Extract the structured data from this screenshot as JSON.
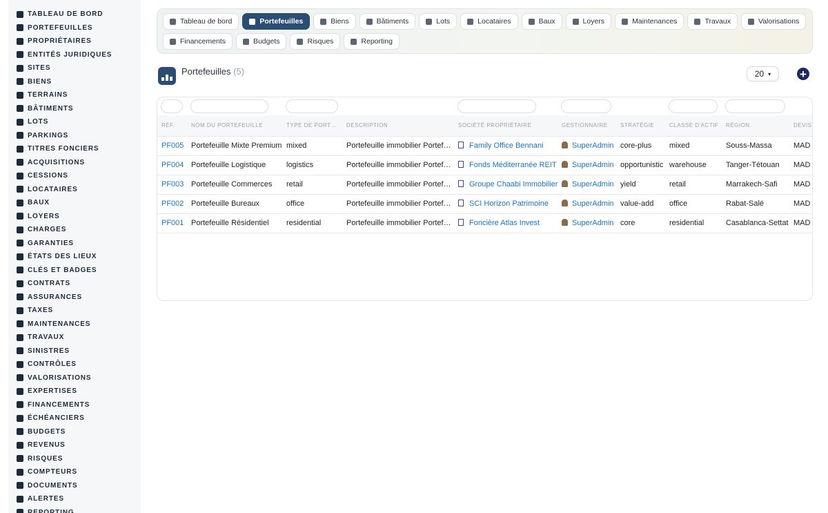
{
  "sidebar": {
    "items": [
      {
        "label": "TABLEAU DE BORD",
        "icon": "dashboard-icon"
      },
      {
        "label": "PORTEFEUILLES",
        "icon": "briefcase-icon"
      },
      {
        "label": "PROPRIÉTAIRES",
        "icon": "user-icon"
      },
      {
        "label": "ENTITÉS JURIDIQUES",
        "icon": "institution-icon"
      },
      {
        "label": "SITES",
        "icon": "city-icon"
      },
      {
        "label": "BIENS",
        "icon": "building-icon"
      },
      {
        "label": "TERRAINS",
        "icon": "vector-square-icon"
      },
      {
        "label": "BÂTIMENTS",
        "icon": "industry-icon"
      },
      {
        "label": "LOTS",
        "icon": "grid-icon"
      },
      {
        "label": "PARKINGS",
        "icon": "parking-icon"
      },
      {
        "label": "TITRES FONCIERS",
        "icon": "file-signature-icon"
      },
      {
        "label": "ACQUISITIONS",
        "icon": "handshake-icon"
      },
      {
        "label": "CESSIONS",
        "icon": "share-icon"
      },
      {
        "label": "LOCATAIRES",
        "icon": "users-icon"
      },
      {
        "label": "BAUX",
        "icon": "file-icon"
      },
      {
        "label": "LOYERS",
        "icon": "receipt-icon"
      },
      {
        "label": "CHARGES",
        "icon": "calculator-icon"
      },
      {
        "label": "GARANTIES",
        "icon": "shield-icon"
      },
      {
        "label": "ÉTATS DES LIEUX",
        "icon": "clipboard-check-icon"
      },
      {
        "label": "CLÉS ET BADGES",
        "icon": "key-icon"
      },
      {
        "label": "CONTRATS",
        "icon": "contract-icon"
      },
      {
        "label": "ASSURANCES",
        "icon": "umbrella-icon"
      },
      {
        "label": "TAXES",
        "icon": "percent-icon"
      },
      {
        "label": "MAINTENANCES",
        "icon": "tools-icon"
      },
      {
        "label": "TRAVAUX",
        "icon": "hard-hat-icon"
      },
      {
        "label": "SINISTRES",
        "icon": "warning-icon"
      },
      {
        "label": "CONTRÔLES",
        "icon": "clipboard-icon"
      },
      {
        "label": "VALORISATIONS",
        "icon": "scale-icon"
      },
      {
        "label": "EXPERTISES",
        "icon": "gavel-icon"
      },
      {
        "label": "FINANCEMENTS",
        "icon": "bank-icon"
      },
      {
        "label": "ÉCHÉANCIERS",
        "icon": "calendar-icon"
      },
      {
        "label": "BUDGETS",
        "icon": "coins-icon"
      },
      {
        "label": "REVENUS",
        "icon": "money-bill-icon"
      },
      {
        "label": "RISQUES",
        "icon": "exclamation-circle-icon"
      },
      {
        "label": "COMPTEURS",
        "icon": "gauge-icon"
      },
      {
        "label": "DOCUMENTS",
        "icon": "folder-open-icon"
      },
      {
        "label": "ALERTES",
        "icon": "bell-icon"
      },
      {
        "label": "REPORTING",
        "icon": "chart-pie-icon"
      }
    ]
  },
  "tabs": {
    "row1": [
      {
        "label": "Tableau de bord",
        "icon": "dashboard-icon",
        "active": false
      },
      {
        "label": "Portefeuilles",
        "icon": "briefcase-icon",
        "active": true
      },
      {
        "label": "Biens",
        "icon": "building-icon",
        "active": false
      },
      {
        "label": "Bâtiments",
        "icon": "industry-icon",
        "active": false
      },
      {
        "label": "Lots",
        "icon": "grid-icon",
        "active": false
      },
      {
        "label": "Locataires",
        "icon": "users-icon",
        "active": false
      },
      {
        "label": "Baux",
        "icon": "file-icon",
        "active": false
      },
      {
        "label": "Loyers",
        "icon": "receipt-icon",
        "active": false
      },
      {
        "label": "Maintenances",
        "icon": "tools-icon",
        "active": false
      },
      {
        "label": "Travaux",
        "icon": "hard-hat-icon",
        "active": false
      },
      {
        "label": "Valorisations",
        "icon": "scale-icon",
        "active": false
      }
    ],
    "row2": [
      {
        "label": "Financements",
        "icon": "bank-icon",
        "active": false
      },
      {
        "label": "Budgets",
        "icon": "coins-icon",
        "active": false
      },
      {
        "label": "Risques",
        "icon": "exclamation-circle-icon",
        "active": false
      },
      {
        "label": "Reporting",
        "icon": "chart-pie-icon",
        "active": false
      }
    ]
  },
  "header": {
    "title": "Portefeuilles",
    "count": "(5)",
    "page_size": "20",
    "add_label": "+"
  },
  "table": {
    "columns": [
      "RÉF.",
      "NOM DU PORTEFEUILLE",
      "TYPE DE PORT…",
      "DESCRIPTION",
      "SOCIÉTÉ PROPRIÉTAIRE",
      "GESTIONNAIRE",
      "STRATÉGIE",
      "CLASSE D'ACTIF",
      "RÉGION",
      "DEVIS"
    ],
    "rows": [
      {
        "ref": "PF005",
        "name": "Portefeuille Mixte Premium",
        "type": "mixed",
        "description": "Portefeuille immobilier Portef…",
        "owner": "Family Office Bennani",
        "manager": "SuperAdmin",
        "strategy": "core-plus",
        "asset_class": "mixed",
        "region": "Souss-Massa",
        "currency": "MAD"
      },
      {
        "ref": "PF004",
        "name": "Portefeuille Logistique",
        "type": "logistics",
        "description": "Portefeuille immobilier Portef…",
        "owner": "Fonds Méditerranée REIT",
        "manager": "SuperAdmin",
        "strategy": "opportunistic",
        "asset_class": "warehouse",
        "region": "Tanger-Tétouan",
        "currency": "MAD"
      },
      {
        "ref": "PF003",
        "name": "Portefeuille Commerces",
        "type": "retail",
        "description": "Portefeuille immobilier Portef…",
        "owner": "Groupe Chaabi Immobilier",
        "manager": "SuperAdmin",
        "strategy": "yield",
        "asset_class": "retail",
        "region": "Marrakech-Safi",
        "currency": "MAD"
      },
      {
        "ref": "PF002",
        "name": "Portefeuille Bureaux",
        "type": "office",
        "description": "Portefeuille immobilier Portef…",
        "owner": "SCI Horizon Patrimoine",
        "manager": "SuperAdmin",
        "strategy": "value-add",
        "asset_class": "office",
        "region": "Rabat-Salé",
        "currency": "MAD"
      },
      {
        "ref": "PF001",
        "name": "Portefeuille Résidentiel",
        "type": "residential",
        "description": "Portefeuille immobilier Portef…",
        "owner": "Foncière Atlas Invest",
        "manager": "SuperAdmin",
        "strategy": "core",
        "asset_class": "residential",
        "region": "Casablanca-Settat",
        "currency": "MAD"
      }
    ]
  },
  "colors": {
    "accent": "#2b4d73",
    "link": "#1a73c9",
    "add_button": "#1f2a5c"
  }
}
